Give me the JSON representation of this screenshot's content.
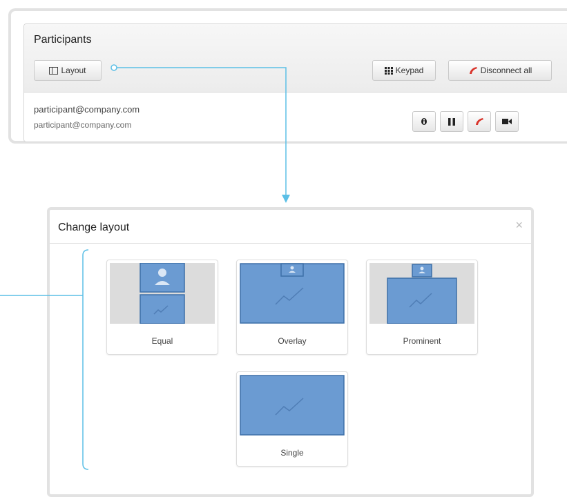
{
  "participants": {
    "title": "Participants",
    "layout_button": "Layout",
    "keypad_button": "Keypad",
    "disconnect_all_button": "Disconnect all",
    "participant": {
      "name": "participant@company.com",
      "address": "participant@company.com"
    },
    "row_actions": [
      "info-icon",
      "pause-icon",
      "hangup-icon",
      "video-icon"
    ]
  },
  "change_layout": {
    "title": "Change layout",
    "close_label": "×",
    "options": [
      {
        "label": "Equal"
      },
      {
        "label": "Overlay"
      },
      {
        "label": "Prominent"
      },
      {
        "label": "Single"
      }
    ]
  },
  "colors": {
    "thumb_blue": "#6b9bd2",
    "thumb_blue_dark": "#3d6fa8",
    "callout_line": "#5bbfe6",
    "hangup_red": "#d9342b"
  }
}
